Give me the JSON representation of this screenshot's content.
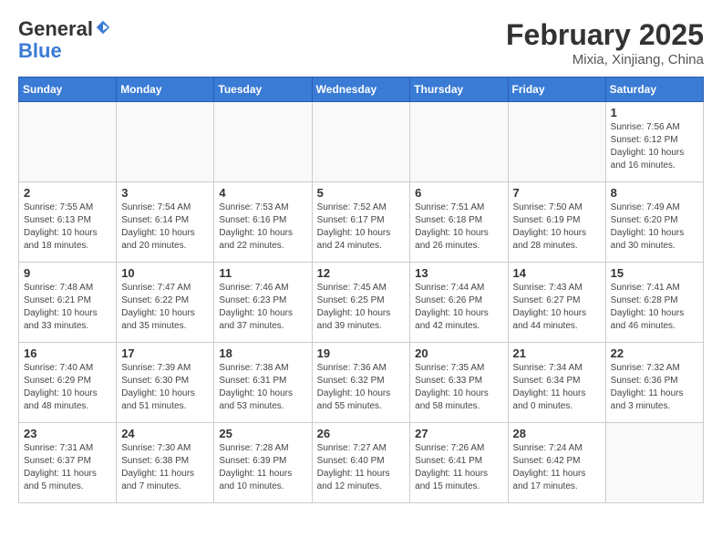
{
  "header": {
    "logo_general": "General",
    "logo_blue": "Blue",
    "month_title": "February 2025",
    "location": "Mixia, Xinjiang, China"
  },
  "days_of_week": [
    "Sunday",
    "Monday",
    "Tuesday",
    "Wednesday",
    "Thursday",
    "Friday",
    "Saturday"
  ],
  "weeks": [
    [
      {
        "day": "",
        "info": ""
      },
      {
        "day": "",
        "info": ""
      },
      {
        "day": "",
        "info": ""
      },
      {
        "day": "",
        "info": ""
      },
      {
        "day": "",
        "info": ""
      },
      {
        "day": "",
        "info": ""
      },
      {
        "day": "1",
        "info": "Sunrise: 7:56 AM\nSunset: 6:12 PM\nDaylight: 10 hours and 16 minutes."
      }
    ],
    [
      {
        "day": "2",
        "info": "Sunrise: 7:55 AM\nSunset: 6:13 PM\nDaylight: 10 hours and 18 minutes."
      },
      {
        "day": "3",
        "info": "Sunrise: 7:54 AM\nSunset: 6:14 PM\nDaylight: 10 hours and 20 minutes."
      },
      {
        "day": "4",
        "info": "Sunrise: 7:53 AM\nSunset: 6:16 PM\nDaylight: 10 hours and 22 minutes."
      },
      {
        "day": "5",
        "info": "Sunrise: 7:52 AM\nSunset: 6:17 PM\nDaylight: 10 hours and 24 minutes."
      },
      {
        "day": "6",
        "info": "Sunrise: 7:51 AM\nSunset: 6:18 PM\nDaylight: 10 hours and 26 minutes."
      },
      {
        "day": "7",
        "info": "Sunrise: 7:50 AM\nSunset: 6:19 PM\nDaylight: 10 hours and 28 minutes."
      },
      {
        "day": "8",
        "info": "Sunrise: 7:49 AM\nSunset: 6:20 PM\nDaylight: 10 hours and 30 minutes."
      }
    ],
    [
      {
        "day": "9",
        "info": "Sunrise: 7:48 AM\nSunset: 6:21 PM\nDaylight: 10 hours and 33 minutes."
      },
      {
        "day": "10",
        "info": "Sunrise: 7:47 AM\nSunset: 6:22 PM\nDaylight: 10 hours and 35 minutes."
      },
      {
        "day": "11",
        "info": "Sunrise: 7:46 AM\nSunset: 6:23 PM\nDaylight: 10 hours and 37 minutes."
      },
      {
        "day": "12",
        "info": "Sunrise: 7:45 AM\nSunset: 6:25 PM\nDaylight: 10 hours and 39 minutes."
      },
      {
        "day": "13",
        "info": "Sunrise: 7:44 AM\nSunset: 6:26 PM\nDaylight: 10 hours and 42 minutes."
      },
      {
        "day": "14",
        "info": "Sunrise: 7:43 AM\nSunset: 6:27 PM\nDaylight: 10 hours and 44 minutes."
      },
      {
        "day": "15",
        "info": "Sunrise: 7:41 AM\nSunset: 6:28 PM\nDaylight: 10 hours and 46 minutes."
      }
    ],
    [
      {
        "day": "16",
        "info": "Sunrise: 7:40 AM\nSunset: 6:29 PM\nDaylight: 10 hours and 48 minutes."
      },
      {
        "day": "17",
        "info": "Sunrise: 7:39 AM\nSunset: 6:30 PM\nDaylight: 10 hours and 51 minutes."
      },
      {
        "day": "18",
        "info": "Sunrise: 7:38 AM\nSunset: 6:31 PM\nDaylight: 10 hours and 53 minutes."
      },
      {
        "day": "19",
        "info": "Sunrise: 7:36 AM\nSunset: 6:32 PM\nDaylight: 10 hours and 55 minutes."
      },
      {
        "day": "20",
        "info": "Sunrise: 7:35 AM\nSunset: 6:33 PM\nDaylight: 10 hours and 58 minutes."
      },
      {
        "day": "21",
        "info": "Sunrise: 7:34 AM\nSunset: 6:34 PM\nDaylight: 11 hours and 0 minutes."
      },
      {
        "day": "22",
        "info": "Sunrise: 7:32 AM\nSunset: 6:36 PM\nDaylight: 11 hours and 3 minutes."
      }
    ],
    [
      {
        "day": "23",
        "info": "Sunrise: 7:31 AM\nSunset: 6:37 PM\nDaylight: 11 hours and 5 minutes."
      },
      {
        "day": "24",
        "info": "Sunrise: 7:30 AM\nSunset: 6:38 PM\nDaylight: 11 hours and 7 minutes."
      },
      {
        "day": "25",
        "info": "Sunrise: 7:28 AM\nSunset: 6:39 PM\nDaylight: 11 hours and 10 minutes."
      },
      {
        "day": "26",
        "info": "Sunrise: 7:27 AM\nSunset: 6:40 PM\nDaylight: 11 hours and 12 minutes."
      },
      {
        "day": "27",
        "info": "Sunrise: 7:26 AM\nSunset: 6:41 PM\nDaylight: 11 hours and 15 minutes."
      },
      {
        "day": "28",
        "info": "Sunrise: 7:24 AM\nSunset: 6:42 PM\nDaylight: 11 hours and 17 minutes."
      },
      {
        "day": "",
        "info": ""
      }
    ]
  ]
}
